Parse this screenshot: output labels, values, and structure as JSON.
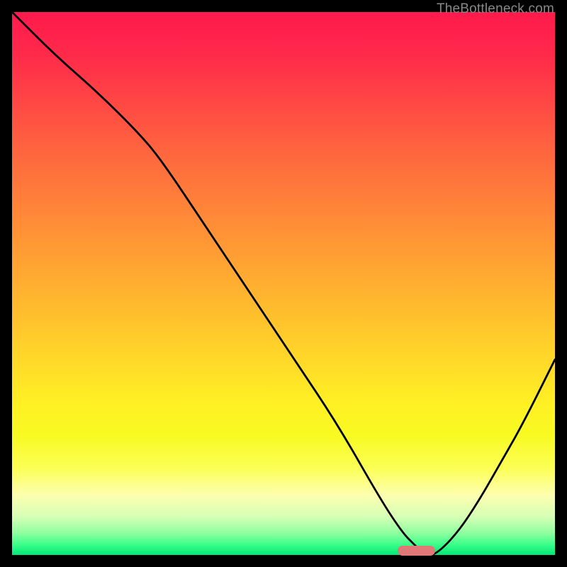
{
  "attribution": "TheBottleneck.com",
  "chart_data": {
    "type": "line",
    "title": "",
    "xlabel": "",
    "ylabel": "",
    "xlim": [
      0,
      100
    ],
    "ylim": [
      0,
      100
    ],
    "series": [
      {
        "name": "bottleneck-curve",
        "x": [
          0,
          8,
          16,
          24,
          28,
          36,
          44,
          52,
          60,
          68,
          72,
          74,
          76,
          78,
          82,
          86,
          90,
          94,
          100
        ],
        "y": [
          100,
          92,
          85,
          77,
          72,
          60,
          48,
          36,
          24,
          10,
          4,
          2,
          0,
          0,
          4,
          10,
          17,
          24,
          36
        ]
      }
    ],
    "marker": {
      "x_start": 71,
      "x_end": 78,
      "y": 0,
      "color": "#e07878"
    },
    "gradient_stops": [
      {
        "pos": 0,
        "color": "#ff1a4d"
      },
      {
        "pos": 50,
        "color": "#ffb030"
      },
      {
        "pos": 80,
        "color": "#fff024"
      },
      {
        "pos": 100,
        "color": "#00e876"
      }
    ]
  }
}
